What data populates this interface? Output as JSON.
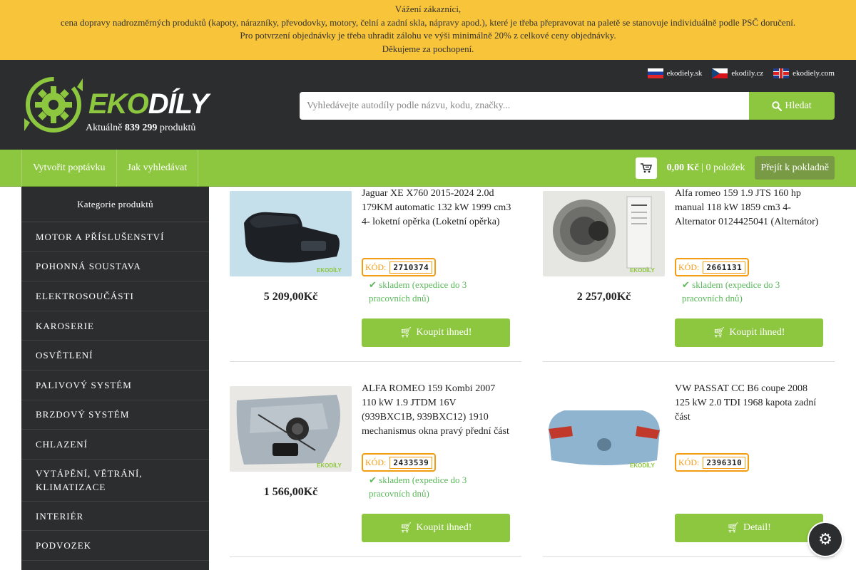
{
  "notice": {
    "line1": "Vážení zákazníci,",
    "line2": "cena dopravy nadrozměrných produktů (kapoty, nárazníky, převodovky, motory, čelní a zadní skla, nápravy apod.), které je třeba přepravovat na paletě se stanovuje individuálně podle PSČ doručení.",
    "line3": "Pro potvrzení objednávky je třeba uhradit zálohu ve výši minimálně 20% z celkové ceny objednávky.",
    "line4": "Děkujeme za pochopení."
  },
  "header": {
    "logo_eko": "EKO",
    "logo_dily": "DÍLY",
    "count_prefix": "Aktuálně",
    "count_value": "839 299",
    "count_suffix": "produktů",
    "langs": [
      {
        "label": "ekodiely.sk",
        "flag": "sk"
      },
      {
        "label": "ekodily.cz",
        "flag": "cz"
      },
      {
        "label": "ekodiely.com",
        "flag": "uk"
      }
    ],
    "search_placeholder": "Vyhledávejte autodíly podle názvu, kodu, značky...",
    "search_button": "Hledat"
  },
  "nav": {
    "links": [
      "Vytvořit poptávku",
      "Jak vyhledávat"
    ],
    "cart_amount": "0,00 Kč",
    "cart_sep": "|",
    "cart_items": "0 položek",
    "checkout": "Přejít k pokladně"
  },
  "sidebar": {
    "title": "Kategorie produktů",
    "categories": [
      "MOTOR A PŘÍSLUŠENSTVÍ",
      "POHONNÁ SOUSTAVA",
      "ELEKTROSOUČÁSTI",
      "KAROSERIE",
      "OSVĚTLENÍ",
      "PALIVOVÝ SYSTÉM",
      "BRZDOVÝ SYSTÉM",
      "CHLAZENÍ",
      "VYTÁPĚNÍ, VĚTRÁNÍ, KLIMATIZACE",
      "INTERIÉR",
      "PODVOZEK"
    ]
  },
  "products": [
    {
      "title": "Jaguar XE X760 2015-2024 2.0d 179KM automatic 132 kW 1999 cm3 4- loketní opěrka (Loketní opěrka)",
      "price": "5 209,00Kč",
      "code_label": "KÓD:",
      "code": "2710374",
      "stock": "skladem (expedice do 3 pracovních dnů)",
      "button": "Koupit ihned!"
    },
    {
      "title": "Alfa romeo 159 1.9 JTS 160 hp manual 118 kW 1859 cm3 4- Alternator 0124425041 (Alternátor)",
      "price": "2 257,00Kč",
      "code_label": "KÓD:",
      "code": "2661131",
      "stock": "skladem (expedice do 3 pracovních dnů)",
      "button": "Koupit ihned!"
    },
    {
      "title": "ALFA ROMEO 159 Kombi 2007 110 kW 1.9 JTDM 16V (939BXC1B, 939BXC12) 1910 mechanismus okna pravý přední část",
      "price": "1 566,00Kč",
      "code_label": "KÓD:",
      "code": "2433539",
      "stock": "skladem (expedice do 3 pracovních dnů)",
      "button": "Koupit ihned!"
    },
    {
      "title": "VW PASSAT CC B6 coupe 2008 125 kW 2.0 TDI 1968 kapota zadní část",
      "price": "",
      "code_label": "KÓD:",
      "code": "2396310",
      "stock": "",
      "button": "Detail!"
    }
  ],
  "colors": {
    "notice_bg": "#f8c43a",
    "header_bg": "#2b2d2e",
    "brand_green": "#8dc63f",
    "code_orange": "#f39c12",
    "stock_green": "#5cb85c"
  }
}
